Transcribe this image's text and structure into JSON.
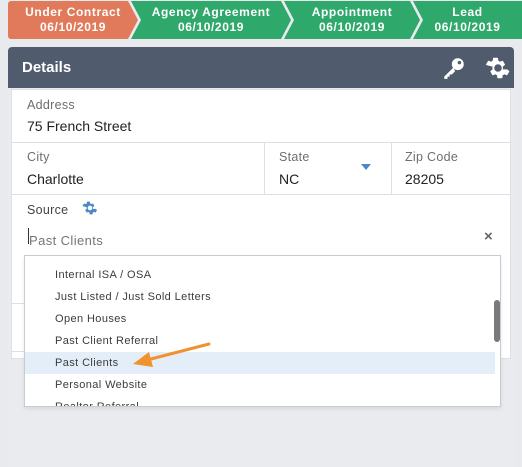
{
  "pipeline": [
    {
      "name": "Under Contract",
      "date": "06/10/2019",
      "color": "#e07a5a"
    },
    {
      "name": "Agency Agreement",
      "date": "06/10/2019",
      "color": "#2fa86b"
    },
    {
      "name": "Appointment",
      "date": "06/10/2019",
      "color": "#2fa86b"
    },
    {
      "name": "Lead",
      "date": "06/10/2019",
      "color": "#2fa86b"
    }
  ],
  "details": {
    "title": "Details",
    "header_icons": [
      "key-icon",
      "gear-icon"
    ],
    "address_label": "Address",
    "address_value": "75 French Street",
    "city_label": "City",
    "city_value": "Charlotte",
    "state_label": "State",
    "state_value": "NC",
    "zip_label": "Zip Code",
    "zip_value": "28205",
    "source_label": "Source",
    "source_placeholder": "Past Clients",
    "clear_label": "×"
  },
  "source_options": [
    {
      "label": "Internal ISA / OSA"
    },
    {
      "label": "Just Listed / Just Sold Letters"
    },
    {
      "label": "Open Houses"
    },
    {
      "label": "Past Client Referral"
    },
    {
      "label": "Past Clients",
      "highlighted": true
    },
    {
      "label": "Personal Website"
    },
    {
      "label": "Realtor Referral"
    }
  ],
  "colors": {
    "header_bg": "#505c6e",
    "accent": "#4a88c8",
    "highlight": "#e3eef9",
    "arrow": "#f0922e"
  }
}
